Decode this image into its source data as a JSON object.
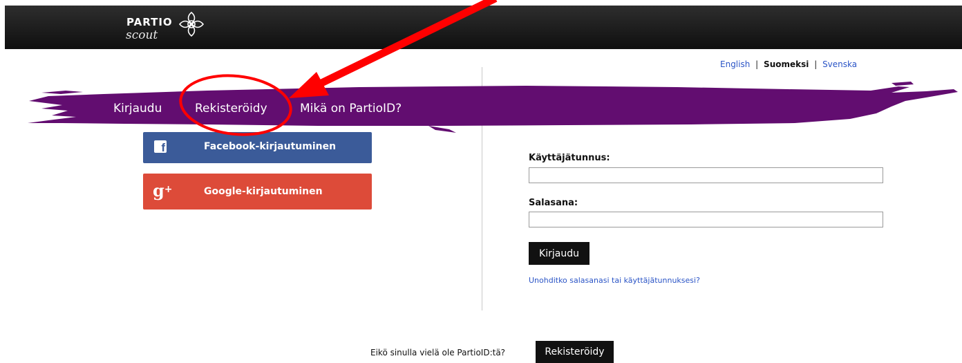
{
  "header": {
    "logo_top": "PARTIO",
    "logo_bottom": "scout"
  },
  "language": {
    "english": "English",
    "separator": "|",
    "current": "Suomeksi",
    "swedish": "Svenska"
  },
  "nav": {
    "login": "Kirjaudu",
    "register": "Rekisteröidy",
    "about": "Mikä on PartioID?"
  },
  "social": {
    "facebook_label": "Facebook-kirjautuminen",
    "facebook_icon": "f",
    "google_label": "Google-kirjautuminen",
    "google_icon": "g",
    "google_plus": "+"
  },
  "form": {
    "username_label": "Käyttäjätunnus:",
    "username_value": "",
    "password_label": "Salasana:",
    "password_value": "",
    "submit_label": "Kirjaudu",
    "forgot_link": "Unohditko salasanasi tai käyttäjätunnuksesi?"
  },
  "footer": {
    "question": "Eikö sinulla vielä ole PartioID:tä?",
    "register_label": "Rekisteröidy"
  },
  "colors": {
    "brush_purple": "#620d70",
    "facebook_blue": "#3b5b99",
    "google_red": "#dd4b39",
    "annotation_red": "#ff0000",
    "link_blue": "#2a54c6"
  }
}
